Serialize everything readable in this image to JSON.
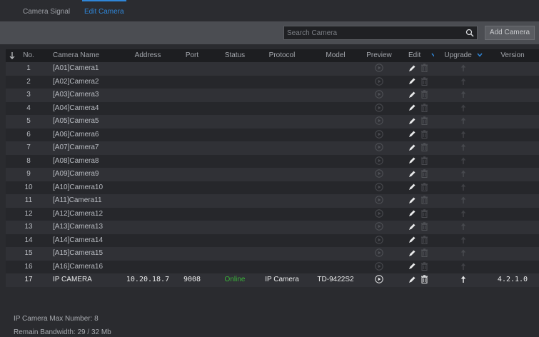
{
  "tabs": [
    {
      "label": "Camera Signal"
    },
    {
      "label": "Edit Camera"
    }
  ],
  "toolbar": {
    "search_placeholder": "Search Camera",
    "add_label": "Add Camera"
  },
  "columns": {
    "no": "No.",
    "name": "Camera Name",
    "address": "Address",
    "port": "Port",
    "status": "Status",
    "protocol": "Protocol",
    "model": "Model",
    "preview": "Preview",
    "edit": "Edit",
    "upgrade": "Upgrade",
    "version": "Version"
  },
  "cameras": [
    {
      "no": "1",
      "name": "[A01]Camera1",
      "address": "",
      "port": "",
      "status": "",
      "protocol": "",
      "model": "",
      "version": ""
    },
    {
      "no": "2",
      "name": "[A02]Camera2",
      "address": "",
      "port": "",
      "status": "",
      "protocol": "",
      "model": "",
      "version": ""
    },
    {
      "no": "3",
      "name": "[A03]Camera3",
      "address": "",
      "port": "",
      "status": "",
      "protocol": "",
      "model": "",
      "version": ""
    },
    {
      "no": "4",
      "name": "[A04]Camera4",
      "address": "",
      "port": "",
      "status": "",
      "protocol": "",
      "model": "",
      "version": ""
    },
    {
      "no": "5",
      "name": "[A05]Camera5",
      "address": "",
      "port": "",
      "status": "",
      "protocol": "",
      "model": "",
      "version": ""
    },
    {
      "no": "6",
      "name": "[A06]Camera6",
      "address": "",
      "port": "",
      "status": "",
      "protocol": "",
      "model": "",
      "version": ""
    },
    {
      "no": "7",
      "name": "[A07]Camera7",
      "address": "",
      "port": "",
      "status": "",
      "protocol": "",
      "model": "",
      "version": ""
    },
    {
      "no": "8",
      "name": "[A08]Camera8",
      "address": "",
      "port": "",
      "status": "",
      "protocol": "",
      "model": "",
      "version": ""
    },
    {
      "no": "9",
      "name": "[A09]Camera9",
      "address": "",
      "port": "",
      "status": "",
      "protocol": "",
      "model": "",
      "version": ""
    },
    {
      "no": "10",
      "name": "[A10]Camera10",
      "address": "",
      "port": "",
      "status": "",
      "protocol": "",
      "model": "",
      "version": ""
    },
    {
      "no": "11",
      "name": "[A11]Camera11",
      "address": "",
      "port": "",
      "status": "",
      "protocol": "",
      "model": "",
      "version": ""
    },
    {
      "no": "12",
      "name": "[A12]Camera12",
      "address": "",
      "port": "",
      "status": "",
      "protocol": "",
      "model": "",
      "version": ""
    },
    {
      "no": "13",
      "name": "[A13]Camera13",
      "address": "",
      "port": "",
      "status": "",
      "protocol": "",
      "model": "",
      "version": ""
    },
    {
      "no": "14",
      "name": "[A14]Camera14",
      "address": "",
      "port": "",
      "status": "",
      "protocol": "",
      "model": "",
      "version": ""
    },
    {
      "no": "15",
      "name": "[A15]Camera15",
      "address": "",
      "port": "",
      "status": "",
      "protocol": "",
      "model": "",
      "version": ""
    },
    {
      "no": "16",
      "name": "[A16]Camera16",
      "address": "",
      "port": "",
      "status": "",
      "protocol": "",
      "model": "",
      "version": ""
    },
    {
      "no": "17",
      "name": "IP CAMERA",
      "address": "10.20.18.7",
      "port": "9008",
      "status": "Online",
      "protocol": "IP Camera",
      "model": "TD-9422S2",
      "version": "4.2.1.0",
      "active": true
    }
  ],
  "footer": {
    "max_number": "IP Camera Max Number: 8",
    "bandwidth": "Remain Bandwidth: 29 / 32 Mb"
  },
  "icons": {
    "sort": "sort-arrow-icon",
    "search": "search-icon",
    "preview": "play-circle-icon",
    "edit": "pencil-icon",
    "delete": "trash-icon",
    "upgrade": "up-arrow-icon",
    "dropdown": "chevron-down-icon"
  },
  "colors": {
    "accent": "#2f86d8",
    "online": "#3ab23a"
  }
}
